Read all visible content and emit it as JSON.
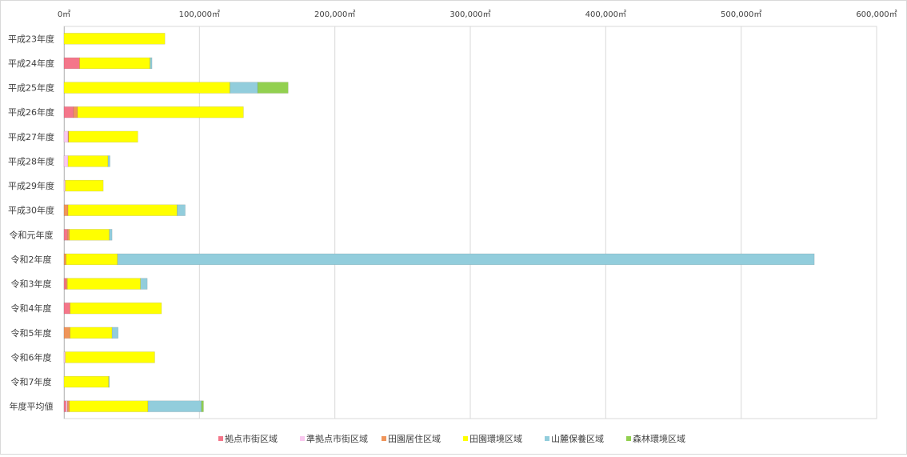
{
  "chart_data": {
    "type": "bar",
    "orientation": "horizontal",
    "stacked": true,
    "title": "",
    "xlabel": "",
    "ylabel": "",
    "xlim": [
      0,
      600000
    ],
    "x_ticks": [
      0,
      100000,
      200000,
      300000,
      400000,
      500000,
      600000
    ],
    "x_tick_labels": [
      "0㎡",
      "100,000㎡",
      "200,000㎡",
      "300,000㎡",
      "400,000㎡",
      "500,000㎡",
      "600,000㎡"
    ],
    "x_axis_position": "top",
    "grid": "vertical",
    "legend_position": "bottom",
    "categories": [
      "平成23年度",
      "平成24年度",
      "平成25年度",
      "平成26年度",
      "平成27年度",
      "平成28年度",
      "平成29年度",
      "平成30年度",
      "令和元年度",
      "令和2年度",
      "令和3年度",
      "令和4年度",
      "令和5年度",
      "令和6年度",
      "令和7年度",
      "年度平均値"
    ],
    "series": [
      {
        "name": "拠点市街区域",
        "color": "#f4768a",
        "values": [
          0,
          11500,
          0,
          7000,
          0,
          0,
          0,
          0,
          2500,
          0,
          1500,
          4500,
          0,
          0,
          0,
          1500
        ]
      },
      {
        "name": "準拠点市街区域",
        "color": "#f9c8ef",
        "values": [
          0,
          0,
          0,
          0,
          3000,
          3000,
          1000,
          0,
          0,
          0,
          0,
          0,
          0,
          1000,
          0,
          1000
        ]
      },
      {
        "name": "田園居住区域",
        "color": "#f0955a",
        "values": [
          0,
          0,
          0,
          3000,
          500,
          0,
          0,
          3000,
          1500,
          1500,
          1000,
          0,
          4500,
          0,
          0,
          1500
        ]
      },
      {
        "name": "田園環境区域",
        "color": "#ffff00",
        "values": [
          74500,
          52000,
          122500,
          122500,
          51000,
          29500,
          28000,
          80500,
          29500,
          38000,
          54000,
          67500,
          31000,
          66000,
          33000,
          58000
        ]
      },
      {
        "name": "山麓保養区域",
        "color": "#92cddc",
        "values": [
          0,
          1500,
          20500,
          0,
          0,
          1500,
          0,
          6000,
          2000,
          514500,
          5000,
          0,
          4500,
          0,
          500,
          39500
        ]
      },
      {
        "name": "森林環境区域",
        "color": "#92d050",
        "values": [
          0,
          0,
          22500,
          0,
          0,
          0,
          0,
          0,
          0,
          0,
          0,
          0,
          0,
          0,
          0,
          1500
        ]
      }
    ]
  }
}
